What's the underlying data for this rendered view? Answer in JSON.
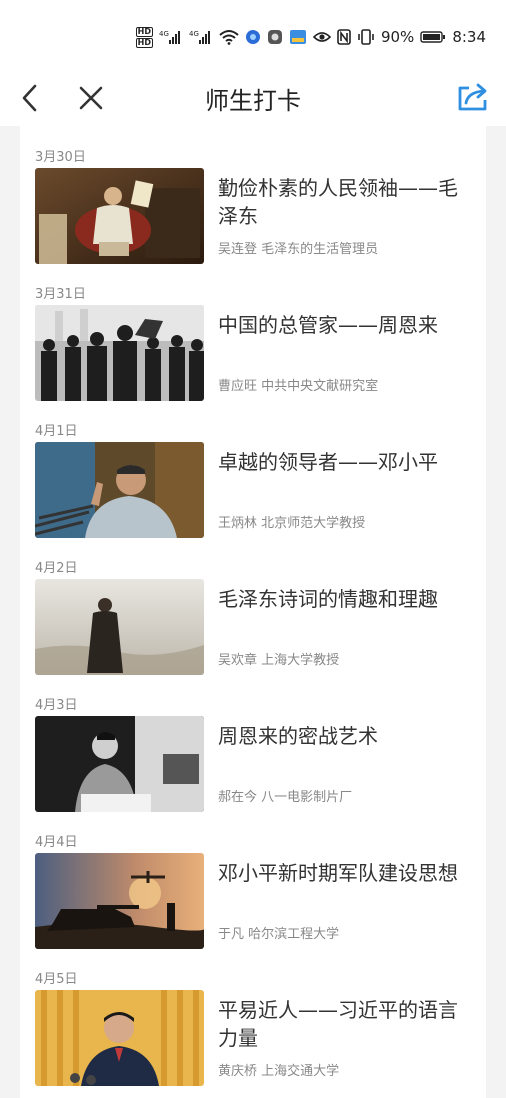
{
  "status_bar": {
    "network_1": "4G",
    "network_2": "4G",
    "battery": "90%",
    "time": "8:34"
  },
  "nav": {
    "title": "师生打卡"
  },
  "entries": [
    {
      "date": "3月30日",
      "title": "勤俭朴素的人民领袖——毛泽东",
      "author": "吴连登 毛泽东的生活管理员"
    },
    {
      "date": "3月31日",
      "title": "中国的总管家——周恩来",
      "author": "曹应旺 中共中央文献研究室"
    },
    {
      "date": "4月1日",
      "title": "卓越的领导者——邓小平",
      "author": "王炳林 北京师范大学教授"
    },
    {
      "date": "4月2日",
      "title": "毛泽东诗词的情趣和理趣",
      "author": "吴欢章 上海大学教授"
    },
    {
      "date": "4月3日",
      "title": "周恩来的密战艺术",
      "author": "郝在今 八一电影制片厂"
    },
    {
      "date": "4月4日",
      "title": "邓小平新时期军队建设思想",
      "author": "于凡 哈尔滨工程大学"
    },
    {
      "date": "4月5日",
      "title": "平易近人——习近平的语言力量",
      "author": "黄庆桥 上海交通大学"
    }
  ],
  "colors": {
    "accent": "#2f8fe0",
    "text_main": "#333333",
    "text_sub": "#888888"
  }
}
